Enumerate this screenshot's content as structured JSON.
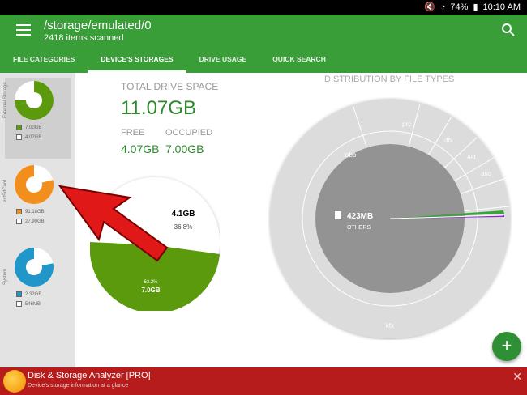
{
  "status_bar": {
    "battery": "74%",
    "time": "10:10 AM"
  },
  "app_bar": {
    "title": "/storage/emulated/0",
    "subtitle": "2418 items scanned",
    "tabs": [
      {
        "label": "FILE CATEGORIES"
      },
      {
        "label": "DEVICE'S STORAGES"
      },
      {
        "label": "DRIVE USAGE"
      },
      {
        "label": "QUICK SEARCH"
      }
    ],
    "active_tab": "DEVICE'S STORAGES"
  },
  "sidebar": {
    "storages": [
      {
        "name": "External Storage",
        "used": "7.00GB",
        "free": "4.07GB",
        "color": "#5b9a0c",
        "used_fraction": 0.632
      },
      {
        "name": "extSdCard",
        "used": "91.18GB",
        "free": "27.90GB",
        "color": "#f28e1c",
        "used_fraction": 0.766
      },
      {
        "name": "System",
        "used": "2.32GB",
        "free": "546MB",
        "color": "#2196c9",
        "used_fraction": 0.81
      }
    ]
  },
  "main": {
    "total_label": "TOTAL DRIVE SPACE",
    "total_value": "11.07GB",
    "free_label": "FREE",
    "free_value": "4.07GB",
    "occupied_label": "OCCUPIED",
    "occupied_value": "7.00GB",
    "pie": {
      "free_size": "4.1GB",
      "free_pct": "36.8%",
      "used_size": "7.0GB",
      "used_pct": "63.2%",
      "used_fraction": 0.632,
      "used_color": "#5b9a0c"
    },
    "distribution_label": "DISTRIBUTION BY FILE TYPES",
    "center_size": "423MB",
    "center_label": "OTHERS",
    "file_types": [
      "obb",
      "prc",
      "db",
      "ast",
      "asc",
      "kfx"
    ]
  },
  "banner": {
    "name": "Disk & Storage Analyzer [PRO]",
    "desc": "Device's storage information at a glance",
    "close": "✕"
  }
}
